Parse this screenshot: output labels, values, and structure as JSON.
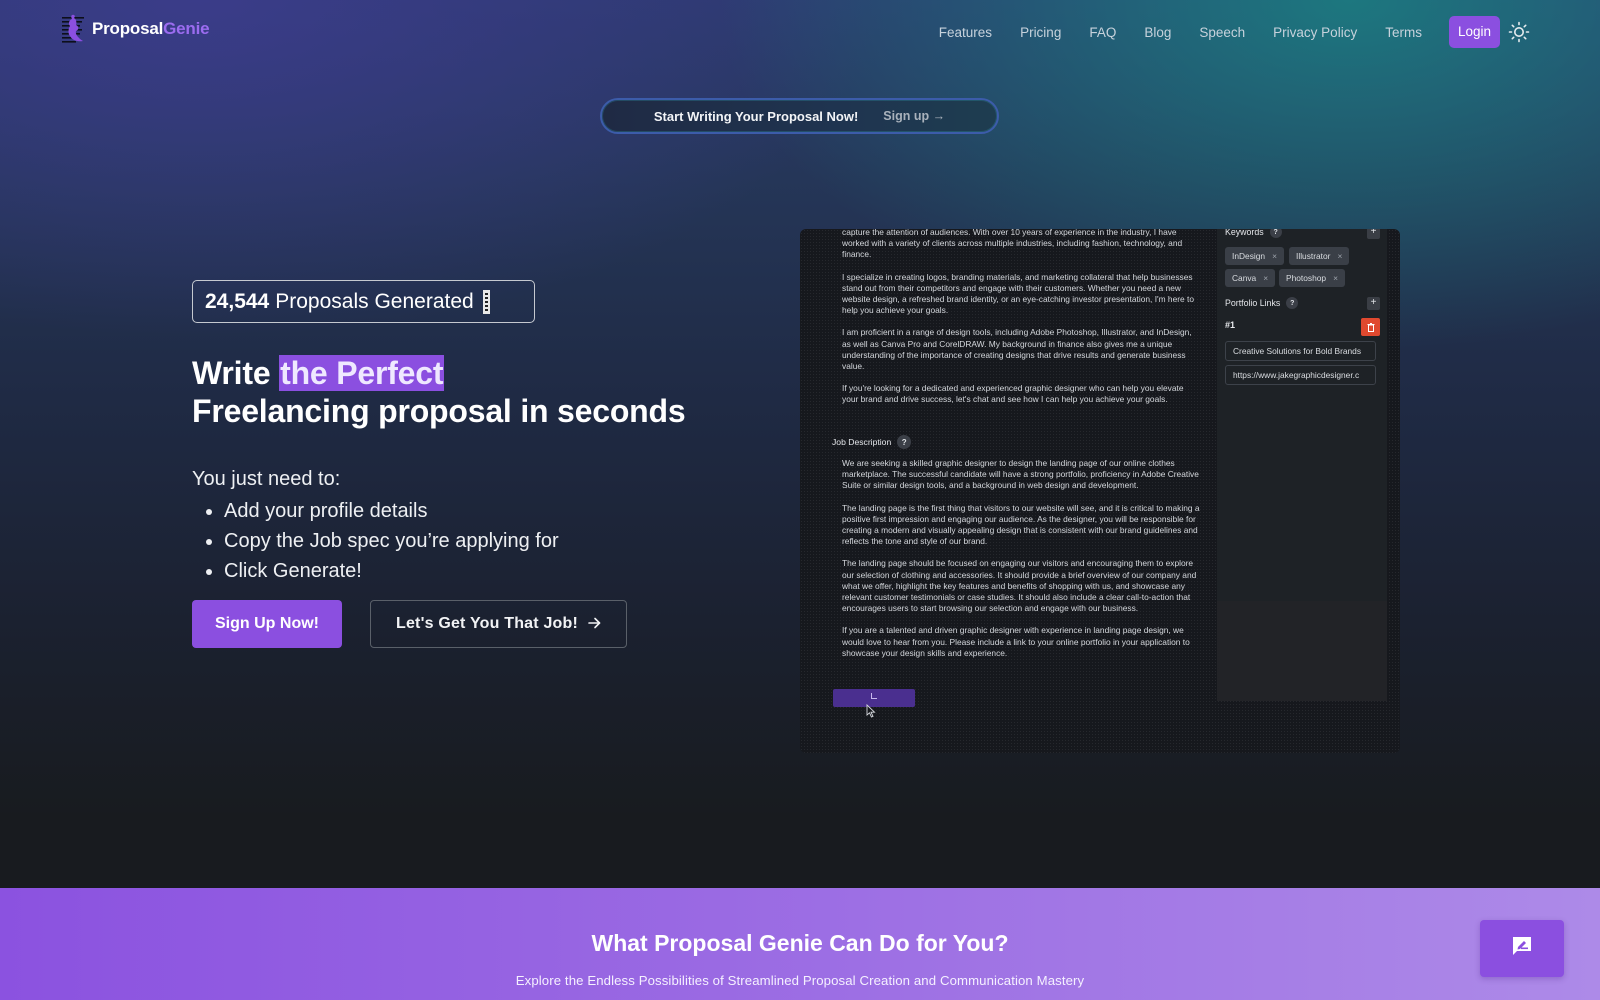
{
  "nav": {
    "brand_part1": "Proposal",
    "brand_part2": "Genie",
    "links": [
      "Features",
      "Pricing",
      "FAQ",
      "Blog",
      "Speech",
      "Privacy Policy",
      "Terms"
    ],
    "login_label": "Login",
    "theme_icon": "sun-icon"
  },
  "announcement": {
    "text": "Start Writing Your Proposal Now!",
    "link_label": "Sign up →"
  },
  "hero": {
    "counter_value": "24,544",
    "counter_label": "Proposals Generated",
    "headline_pre": "Write ",
    "headline_highlight": "the Perfect",
    "headline_line2": "Freelancing proposal in seconds",
    "needs_title": "You just need to:",
    "steps": [
      "Add your profile details",
      "Copy the Job spec you’re applying for",
      "Click Generate!"
    ],
    "primary_cta": "Sign Up Now!",
    "secondary_cta": "Let's Get You That Job!",
    "secondary_cta_icon": "arrow-right-icon"
  },
  "demo": {
    "profile_paragraphs": [
      "capture the attention of audiences. With over 10 years of experience in the industry, I have worked with a variety of clients across multiple industries, including fashion, technology, and finance.",
      "I specialize in creating logos, branding materials, and marketing collateral that help businesses stand out from their competitors and engage with their customers. Whether you need a new website design, a refreshed brand identity, or an eye-catching investor presentation, I'm here to help you achieve your goals.",
      "I am proficient in a range of design tools, including Adobe Photoshop, Illustrator, and InDesign, as well as Canva Pro and CorelDRAW. My background in finance also gives me a unique understanding of the importance of creating designs that drive results and generate business value.",
      "If you're looking for a dedicated and experienced graphic designer who can help you elevate your brand and drive success, let's chat and see how I can help you achieve your goals."
    ],
    "job_label": "Job Description",
    "job_paragraphs": [
      "We are seeking a skilled graphic designer to design the landing page of our online clothes marketplace. The successful candidate will have a strong portfolio, proficiency in Adobe Creative Suite or similar design tools, and a background in web design and development.",
      "The landing page is the first thing that visitors to our website will see, and it is critical to making a positive first impression and engaging our audience. As the designer, you will be responsible for creating a modern and visually appealing design that is consistent with our brand guidelines and reflects the tone and style of our brand.",
      "The landing page should be focused on engaging our visitors and encouraging them to explore our selection of clothing and accessories. It should provide a brief overview of our company and what we offer, highlight the key features and benefits of shopping with us, and showcase any relevant customer testimonials or case studies. It should also include a clear call-to-action that encourages users to start browsing our selection and engage with our business.",
      "If you are a talented and driven graphic designer with experience in landing page design, we would love to hear from you. Please include a link to your online portfolio in your application to showcase your design skills and experience."
    ],
    "keywords_label": "Keywords",
    "keywords": [
      "InDesign",
      "Illustrator",
      "Canva",
      "Photoshop"
    ],
    "portfolio_label": "Portfolio Links",
    "portfolio_item_number": "#1",
    "portfolio_title": "Creative Solutions for Bold Brands",
    "portfolio_url": "https://www.jakegraphicdesigner.c",
    "help_glyph": "?",
    "add_glyph": "+",
    "remove_glyph": "×"
  },
  "features": {
    "title": "What Proposal Genie Can Do for You?",
    "subtitle": "Explore the Endless Possibilities of Streamlined Proposal Creation and Communication Mastery"
  },
  "colors": {
    "accent": "#8b4fe0",
    "danger": "#e0492f",
    "brand_secondary": "#9b6cf0"
  }
}
